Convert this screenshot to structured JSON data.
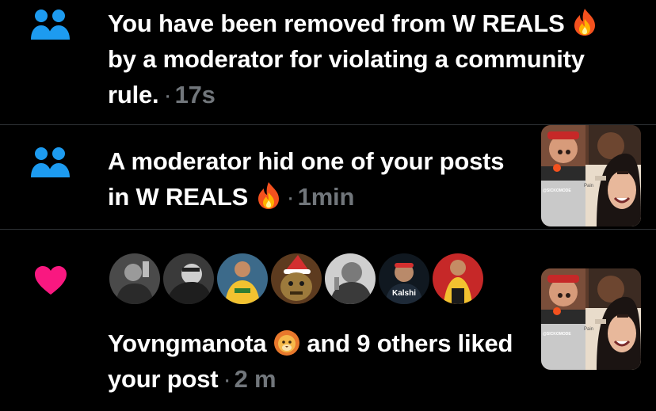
{
  "colors": {
    "background": "#000000",
    "text": "#ffffff",
    "muted": "#71767b",
    "community_icon": "#1d9bf0",
    "heart": "#f91880",
    "divider": "#2f3336"
  },
  "notifications": [
    {
      "icon": "community-icon",
      "text_before": "You have been removed from W REALS",
      "emoji": "fire-emoji",
      "text_after": "by a moderator for violating a community rule.",
      "time": "17s"
    },
    {
      "icon": "community-icon",
      "text": "A moderator hid one of your posts in W REALS",
      "emoji": "fire-emoji",
      "time": "1min",
      "thumbnail": {
        "watermark": "@SICKOMODE",
        "caption": "Pain"
      }
    },
    {
      "icon": "heart-icon",
      "avatars": [
        {
          "label": ""
        },
        {
          "label": ""
        },
        {
          "label": ""
        },
        {
          "label": ""
        },
        {
          "label": ""
        },
        {
          "label": "Kalshi"
        },
        {
          "label": ""
        }
      ],
      "user": "Yovngmanota",
      "emoji": "lion-emoji",
      "text": "and 9 others liked your post",
      "time": "2 m",
      "thumbnail": {
        "watermark": "@SICKOMODE",
        "caption": "Pain"
      }
    }
  ]
}
